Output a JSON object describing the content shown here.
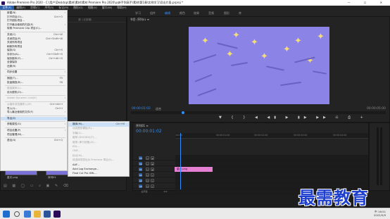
{
  "titlebar": {
    "title": "Adobe Premiere Pro 2020 - C:\\用户\\Desktop\\素材\\素材\\素材 Premiere Pro 2020\\从新手到高手\\素材\\第1章\\实例学习\\导出片段.prproj *",
    "window_controls": "— ☐ ✕"
  },
  "menubar": {
    "items": [
      "文件(F)",
      "编辑(E)",
      "剪辑(C)",
      "序列(S)",
      "标记(M)",
      "图形(G)",
      "视图(V)",
      "窗口(W)",
      "帮助(H)"
    ]
  },
  "workspace": {
    "tabs": [
      "学习",
      "组件",
      "编辑",
      "颜色",
      "效果",
      "音频",
      "图形",
      "库"
    ],
    "active_index": 2,
    "more": "»"
  },
  "source_panel": {
    "tabs": [
      "音频剪辑混合器",
      "元数据",
      "效果控件",
      "源: (无剪辑)"
    ]
  },
  "program_panel": {
    "tab": "节目: 序列01 ≡",
    "timecode_current": "00:00:01:02",
    "fit": "适合",
    "timecode_total": "00:00:05:00",
    "controls": "▼ { } ◀ ◀▮ ▶ ▮▶ ▶▶ ⎌ ⎙ +",
    "screen_color": "#8b83e6"
  },
  "project_panel": {
    "name": "项目: 导出片段",
    "items": [
      {
        "label": "星光.png",
        "duration": "5:00"
      },
      {
        "label": "序列01",
        "duration": "5:00"
      }
    ],
    "footer_icons": "▤ ▦ ◯ ▭ ⌕ ▣ ✎ ⌫"
  },
  "timeline": {
    "tab": "序列01 ≡",
    "timecode": "00:00:01:02",
    "ruler": [
      ":00:00",
      "00:00:01:00",
      "00:00:02:00",
      "00:00:03:00",
      "00:00:04:00"
    ],
    "tracks": [
      {
        "name": "V3",
        "icons": [
          "⊡",
          "◉"
        ]
      },
      {
        "name": "V2",
        "icons": [
          "⊡",
          "◉"
        ]
      },
      {
        "name": "V1",
        "icons": [
          "⊡",
          "◉"
        ]
      },
      {
        "name": "A1",
        "icons": [
          "M",
          "S"
        ]
      },
      {
        "name": "A2",
        "icons": [
          "M",
          "S"
        ]
      },
      {
        "name": "A3",
        "icons": [
          "M",
          "S"
        ]
      },
      {
        "name": "主声道",
        "icons": [
          "0.0"
        ]
      }
    ],
    "clip_label": "星光.png"
  },
  "file_menu": {
    "items": [
      {
        "label": "新建(N)",
        "arrow": true,
        "enabled": true
      },
      {
        "label": "打开项目(O)...",
        "shortcut": "Ctrl+O",
        "enabled": true
      },
      {
        "label": "打开团队项目...",
        "enabled": true
      },
      {
        "label": "打开最近使用的内容(E)",
        "arrow": true,
        "enabled": true
      },
      {
        "label": "转换 Premiere Clip 项目(C)...",
        "enabled": true
      },
      {
        "sep": true
      },
      {
        "label": "关闭(C)",
        "shortcut": "Ctrl+W",
        "enabled": true
      },
      {
        "label": "关闭项目(P)",
        "shortcut": "Ctrl+Shift+W",
        "enabled": true
      },
      {
        "label": "关闭所有项目",
        "enabled": true
      },
      {
        "label": "刷新所有项目",
        "enabled": true
      },
      {
        "label": "保存(S)",
        "shortcut": "Ctrl+S",
        "enabled": true
      },
      {
        "label": "另存为(A)...",
        "shortcut": "Ctrl+Shift+S",
        "enabled": true
      },
      {
        "label": "保存副本(Y)...",
        "shortcut": "Ctrl+Alt+S",
        "enabled": true
      },
      {
        "label": "全部保存",
        "enabled": true
      },
      {
        "label": "还原(R)",
        "enabled": true
      },
      {
        "sep": true
      },
      {
        "label": "同步设置",
        "arrow": true,
        "enabled": true
      },
      {
        "sep": true
      },
      {
        "label": "捕捉(T)...",
        "shortcut": "F5",
        "enabled": true
      },
      {
        "label": "批量捕捉(B)...",
        "shortcut": "F6",
        "enabled": true
      },
      {
        "sep": true
      },
      {
        "label": "链接媒体(L)...",
        "enabled": false
      },
      {
        "label": "设为脱机(O)...",
        "enabled": true
      },
      {
        "sep": true
      },
      {
        "label": "Adobe Dynamic Link(K)",
        "arrow": true,
        "enabled": false
      },
      {
        "sep": true
      },
      {
        "label": "从媒体浏览器导入(M)",
        "shortcut": "Ctrl+Alt+I",
        "enabled": false
      },
      {
        "label": "导入(I)...",
        "shortcut": "Ctrl+I",
        "enabled": true
      },
      {
        "label": "导入最近使用的文件(F)",
        "arrow": true,
        "enabled": true
      },
      {
        "sep": true
      },
      {
        "label": "导出(E)",
        "arrow": true,
        "enabled": true,
        "highlight": true
      },
      {
        "sep": true
      },
      {
        "label": "获取属性(G)",
        "arrow": true,
        "enabled": true
      },
      {
        "sep": true
      },
      {
        "label": "项目设置(P)",
        "arrow": true,
        "enabled": true
      },
      {
        "label": "项目管理(M)...",
        "enabled": true
      },
      {
        "sep": true
      },
      {
        "label": "退出(X)",
        "shortcut": "Ctrl+Q",
        "enabled": true
      }
    ]
  },
  "export_menu": {
    "items": [
      {
        "label": "媒体(M)...",
        "shortcut": "Ctrl+M",
        "enabled": true
      },
      {
        "label": "动态图形模板(R)...",
        "enabled": false
      },
      {
        "label": "字幕(C)...",
        "enabled": false
      },
      {
        "label": "磁带 (DV/HDV)(T)...",
        "enabled": false
      },
      {
        "label": "磁带 (串行设备)(S)...",
        "enabled": false
      },
      {
        "label": "EDL...",
        "enabled": false
      },
      {
        "label": "OMF...",
        "enabled": false
      },
      {
        "label": "标记(M)...",
        "enabled": false
      },
      {
        "label": "将选择项导出为 Premiere 项目(S)...",
        "enabled": false
      },
      {
        "label": "AAF...",
        "enabled": true
      },
      {
        "label": "Avid Log Exchange...",
        "enabled": true
      },
      {
        "label": "Final Cut Pro XML...",
        "enabled": true
      }
    ]
  },
  "watermark": "最需教育",
  "tray": {
    "time": "16:51",
    "date": "2022/5/9",
    "lang": "中"
  },
  "colors": {
    "accent": "#2f8fff",
    "menu_highlight": "#cce1f8",
    "clip": "#e47fd1",
    "star": "#f3dc7a"
  }
}
